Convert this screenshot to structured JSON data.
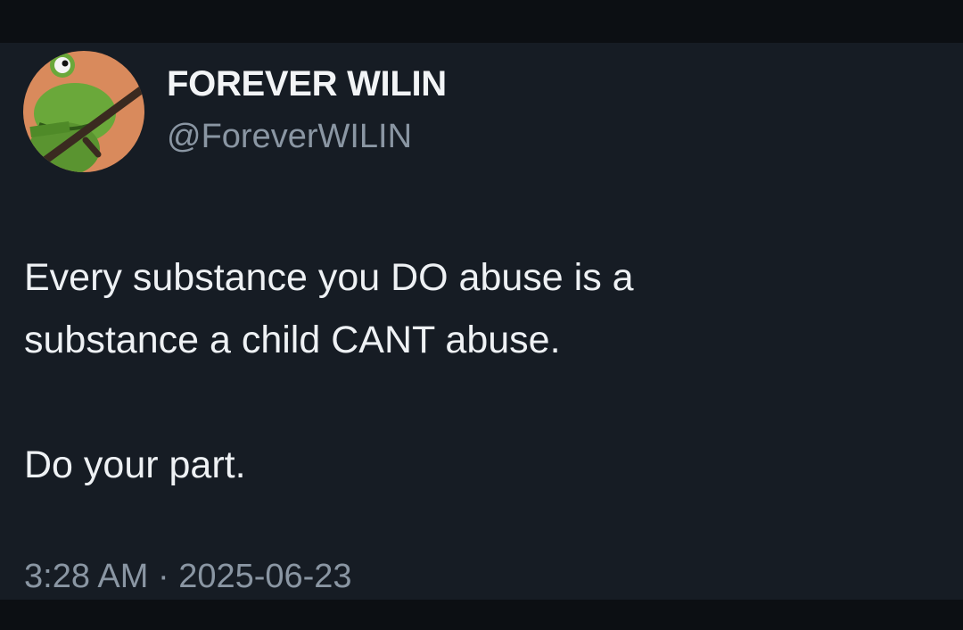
{
  "user": {
    "display_name": "FOREVER WILIN",
    "handle": "@ForeverWILIN",
    "avatar_icon": "frog-avatar-icon"
  },
  "tweet": {
    "line_1": "Every substance you DO abuse is a",
    "line_2": "substance a child CANT abuse.",
    "line_3": "Do your part.",
    "timestamp": "3:28 AM · 2025-06-23"
  },
  "colors": {
    "background": "#161c24",
    "text": "#eef1f4",
    "secondary_text": "#8a96a3"
  }
}
